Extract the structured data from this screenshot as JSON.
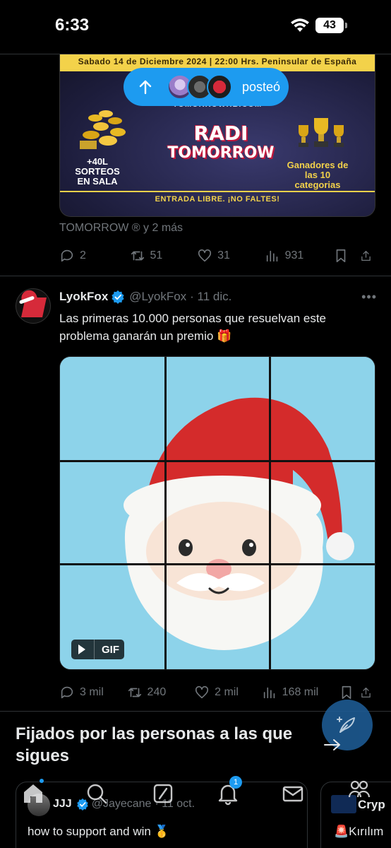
{
  "status_bar": {
    "time": "6:33",
    "battery": "43",
    "icons": [
      "wifi-icon",
      "battery-icon"
    ]
  },
  "banner": {
    "top_strip": "Sabado 14 de Diciembre 2024  |  22:00 Hrs. Peninsular de España",
    "site": "TOMORROWHB.COM",
    "title_line1": "RADI",
    "title_line2": "TOMORROW",
    "left_text": "+40L SORTEOS EN SALA",
    "right_text": "Ganadores de las 10 categorias",
    "footer": "ENTRADA LIBRE. ¡NO FALTES!"
  },
  "repost_pill": {
    "label": "posteó",
    "icons": [
      "arrow-up-icon"
    ]
  },
  "post1": {
    "reposters": "TOMORROW ® y 2 más",
    "actions": {
      "replies": "2",
      "reposts": "51",
      "likes": "31",
      "views": "931"
    }
  },
  "post2": {
    "name": "LyokFox",
    "handle": "@LyokFox",
    "date": "· 11 dic.",
    "text": "Las primeras 10.000 personas que resuelvan este problema ganarán un premio 🎁",
    "media_badge": "GIF",
    "actions": {
      "replies": "3 mil",
      "reposts": "240",
      "likes": "2 mil",
      "views": "168 mil"
    }
  },
  "pinned_section": {
    "title": "Fijados por las personas a las que sigues"
  },
  "pinned_cards": [
    {
      "name": "JJJ",
      "handle": "@Jayecane",
      "date": "· 11 oct.",
      "text": "how to support and win 🥇"
    },
    {
      "name": "Cryp",
      "text": "🚨Kırılım"
    }
  ],
  "tab_bar": {
    "notifications_count": "1",
    "tabs": [
      "home-icon",
      "search-icon",
      "grok-icon",
      "notifications-icon",
      "messages-icon",
      "communities-icon"
    ]
  },
  "colors": {
    "accent": "#1d9bf0",
    "background": "#000000",
    "muted": "#71767b"
  }
}
